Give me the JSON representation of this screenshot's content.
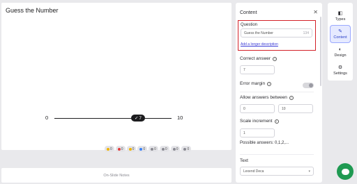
{
  "slide": {
    "title": "Guess the Number",
    "scale": {
      "min": "0",
      "max": "10",
      "value": "7"
    },
    "reactions": [
      {
        "count": "0",
        "color": "#f0b400"
      },
      {
        "count": "0",
        "color": "#e23a3a"
      },
      {
        "count": "0",
        "color": "#f0b400"
      },
      {
        "count": "0",
        "color": "#3b82f6"
      },
      {
        "count": "0",
        "color": "#8a8a92"
      },
      {
        "count": "0",
        "color": "#8a8a92"
      },
      {
        "count": "0",
        "color": "#8a8a92"
      },
      {
        "count": "0",
        "color": "#8a8a92"
      }
    ],
    "notes_label": "On-Slide Notes"
  },
  "panel": {
    "header": "Content",
    "question_label": "Question",
    "question_value": "Guess the Number",
    "question_char_count": "134",
    "description_link": "Add a longer description",
    "correct_answer_label": "Correct answer",
    "correct_answer_value": "7",
    "error_margin_label": "Error margin",
    "allow_between_label": "Allow answers between",
    "range_min": "0",
    "range_max": "10",
    "increment_label": "Scale increment",
    "increment_value": "1",
    "possible_answers": "Possible answers: 0,1,2,...",
    "text_label": "Text",
    "font_value": "Lexend Deca"
  },
  "nav": {
    "items": [
      {
        "label": "Types",
        "icon": "types-icon"
      },
      {
        "label": "Content",
        "icon": "content-icon"
      },
      {
        "label": "Design",
        "icon": "design-icon"
      },
      {
        "label": "Settings",
        "icon": "settings-icon"
      }
    ]
  },
  "colors": {
    "accent": "#2b40c8",
    "highlight": "#d32027",
    "chat": "#1f9a52"
  }
}
